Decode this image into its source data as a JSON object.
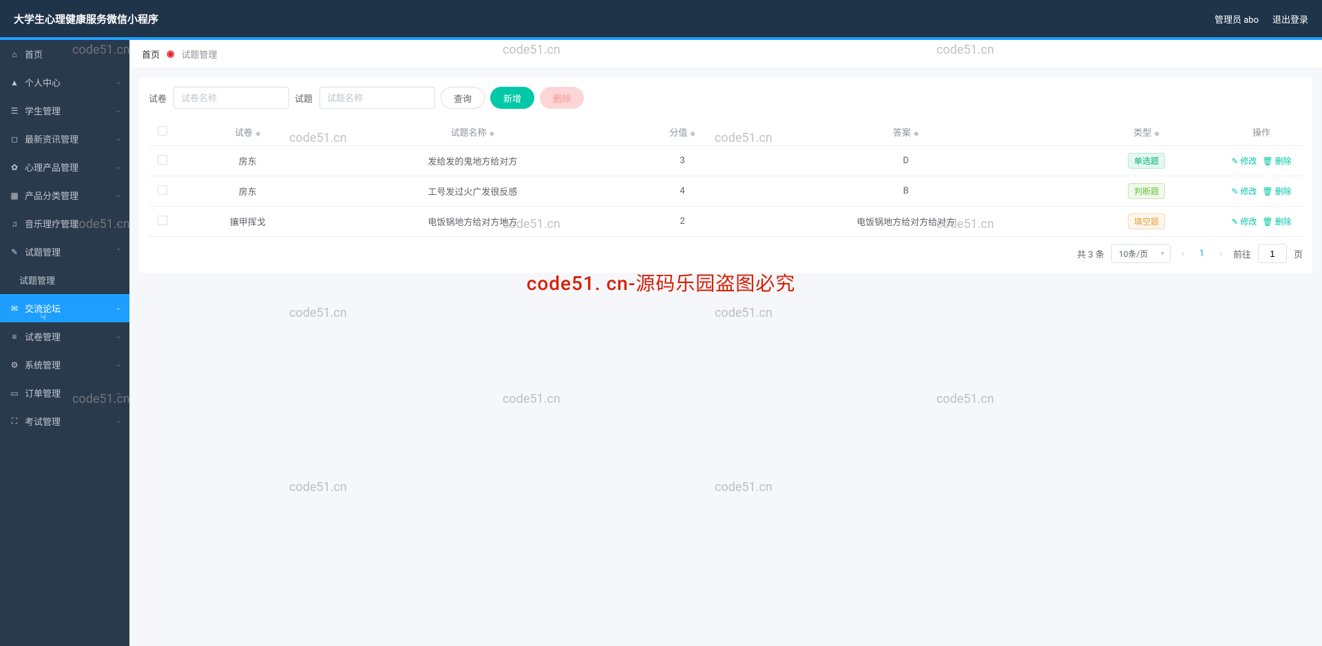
{
  "topbar": {
    "title": "大学生心理健康服务微信小程序",
    "admin_label": "管理员 abo",
    "logout_label": "退出登录"
  },
  "sidebar": {
    "items": [
      {
        "icon": "⌂",
        "label": "首页",
        "has_children": false
      },
      {
        "icon": "▲",
        "label": "个人中心",
        "has_children": true
      },
      {
        "icon": "☰",
        "label": "学生管理",
        "has_children": true
      },
      {
        "icon": "◻",
        "label": "最新资讯管理",
        "has_children": true
      },
      {
        "icon": "✿",
        "label": "心理产品管理",
        "has_children": true
      },
      {
        "icon": "▦",
        "label": "产品分类管理",
        "has_children": true
      },
      {
        "icon": "♫",
        "label": "音乐理疗管理",
        "has_children": true
      },
      {
        "icon": "✎",
        "label": "试题管理",
        "has_children": true,
        "expanded": true
      },
      {
        "icon": "",
        "label": "试题管理",
        "has_children": false,
        "sub": true
      },
      {
        "icon": "✉",
        "label": "交流论坛",
        "has_children": true,
        "active": true
      },
      {
        "icon": "≡",
        "label": "试卷管理",
        "has_children": true
      },
      {
        "icon": "⚙",
        "label": "系统管理",
        "has_children": true
      },
      {
        "icon": "▭",
        "label": "订单管理",
        "has_children": true
      },
      {
        "icon": "⛶",
        "label": "考试管理",
        "has_children": true
      }
    ]
  },
  "breadcrumb": {
    "home": "首页",
    "current": "试题管理"
  },
  "search": {
    "paper_label": "试卷",
    "paper_placeholder": "试卷名称",
    "question_label": "试题",
    "question_placeholder": "试题名称",
    "query_btn": "查询",
    "add_btn": "新增",
    "delete_btn": "删除"
  },
  "table": {
    "headers": {
      "paper": "试卷",
      "qname": "试题名称",
      "score": "分值",
      "answer": "答案",
      "type": "类型",
      "ops": "操作"
    },
    "rows": [
      {
        "paper": "房东",
        "qname": "发给发的鬼地方给对方",
        "score": "3",
        "answer": "D",
        "type": "单选题",
        "type_class": "tag-green"
      },
      {
        "paper": "房东",
        "qname": "工号发过火广发很反感",
        "score": "4",
        "answer": "B",
        "type": "判断题",
        "type_class": "tag-lime"
      },
      {
        "paper": "攘甲挥戈",
        "qname": "电饭锅地方给对方地方",
        "score": "2",
        "answer": "电饭锅地方给对方给对方",
        "type": "填空题",
        "type_class": "tag-orange"
      }
    ],
    "edit_label": "修改",
    "delete_label": "删除"
  },
  "pagination": {
    "total": "共 3 条",
    "per_page": "10条/页",
    "current": "1",
    "goto": "前往",
    "goto_value": "1",
    "page_suffix": "页"
  },
  "watermark": {
    "small": "code51.cn",
    "big": "code51. cn-源码乐园盗图必究"
  }
}
